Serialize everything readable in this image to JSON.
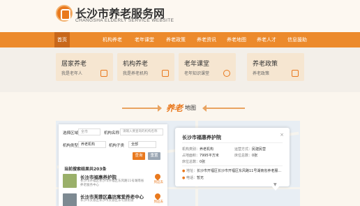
{
  "header": {
    "title": "长沙市养老服务网",
    "subtitle": "CHANGSHA ELDERLY SERVICE WEBSITE"
  },
  "nav": {
    "items": [
      "首页",
      "机构养老",
      "老年课堂",
      "养老政策",
      "养老资讯",
      "养老地图",
      "养老人才",
      "信息援助"
    ],
    "active_index": 0
  },
  "service_cards": [
    {
      "title": "居家养老",
      "subtitle": "我是老年人",
      "icon": "home-icon"
    },
    {
      "title": "机构养老",
      "subtitle": "我是养老机构",
      "icon": "document-icon"
    },
    {
      "title": "老年课堂",
      "subtitle": "老年知识课堂",
      "icon": "play-icon"
    },
    {
      "title": "养老政策",
      "subtitle": "养老政策",
      "icon": "book-icon"
    }
  ],
  "map_section": {
    "title_highlight": "养老",
    "title_rest": "地图"
  },
  "search_panel": {
    "region_label": "选择区域",
    "region_placeholder": "全市",
    "name_label": "机构名称",
    "name_placeholder": "请输入要查询的机构名称",
    "type_label": "机构类型",
    "type_value": "养老机构",
    "nature_label": "机构子类",
    "nature_value": "全部",
    "search_button": "查询",
    "reset_button": "重置",
    "result_count": "当前搜索结果共203条",
    "results": [
      {
        "name": "长沙市福惠养护院",
        "address": "长沙市开福区长沙市开福区东风路11号湖南省养老服务中心",
        "nav": "到这去"
      },
      {
        "name": "长沙市芙蓉区鑫坊寓爱养老中心",
        "address": "长沙市芙蓉区长沙市芙蓉区东屯渡街道",
        "nav": "到这去"
      }
    ]
  },
  "popup": {
    "title": "长沙市福惠养护院",
    "close": "×",
    "rows": [
      {
        "label": "机构类别：",
        "value": "养老机构",
        "label2": "运营方式：",
        "value2": "民建民营"
      },
      {
        "label": "占地面积：",
        "value": "7995平方米",
        "label2": "床位总数：",
        "value2": "0张"
      },
      {
        "label": "床位总数：",
        "value": "0张"
      }
    ],
    "address_label": "地址：",
    "address_value": "长沙市开福区长沙市开福区东风路11号湖南省养老服...",
    "phone_label": "电话：",
    "phone_value": "暂无"
  },
  "colors": {
    "primary": "#ec8a2c",
    "primary_dark": "#c8671a",
    "card_bg": "#f6e6d1",
    "search_btn": "#e9791e",
    "reset_btn": "#9aa6b3"
  }
}
